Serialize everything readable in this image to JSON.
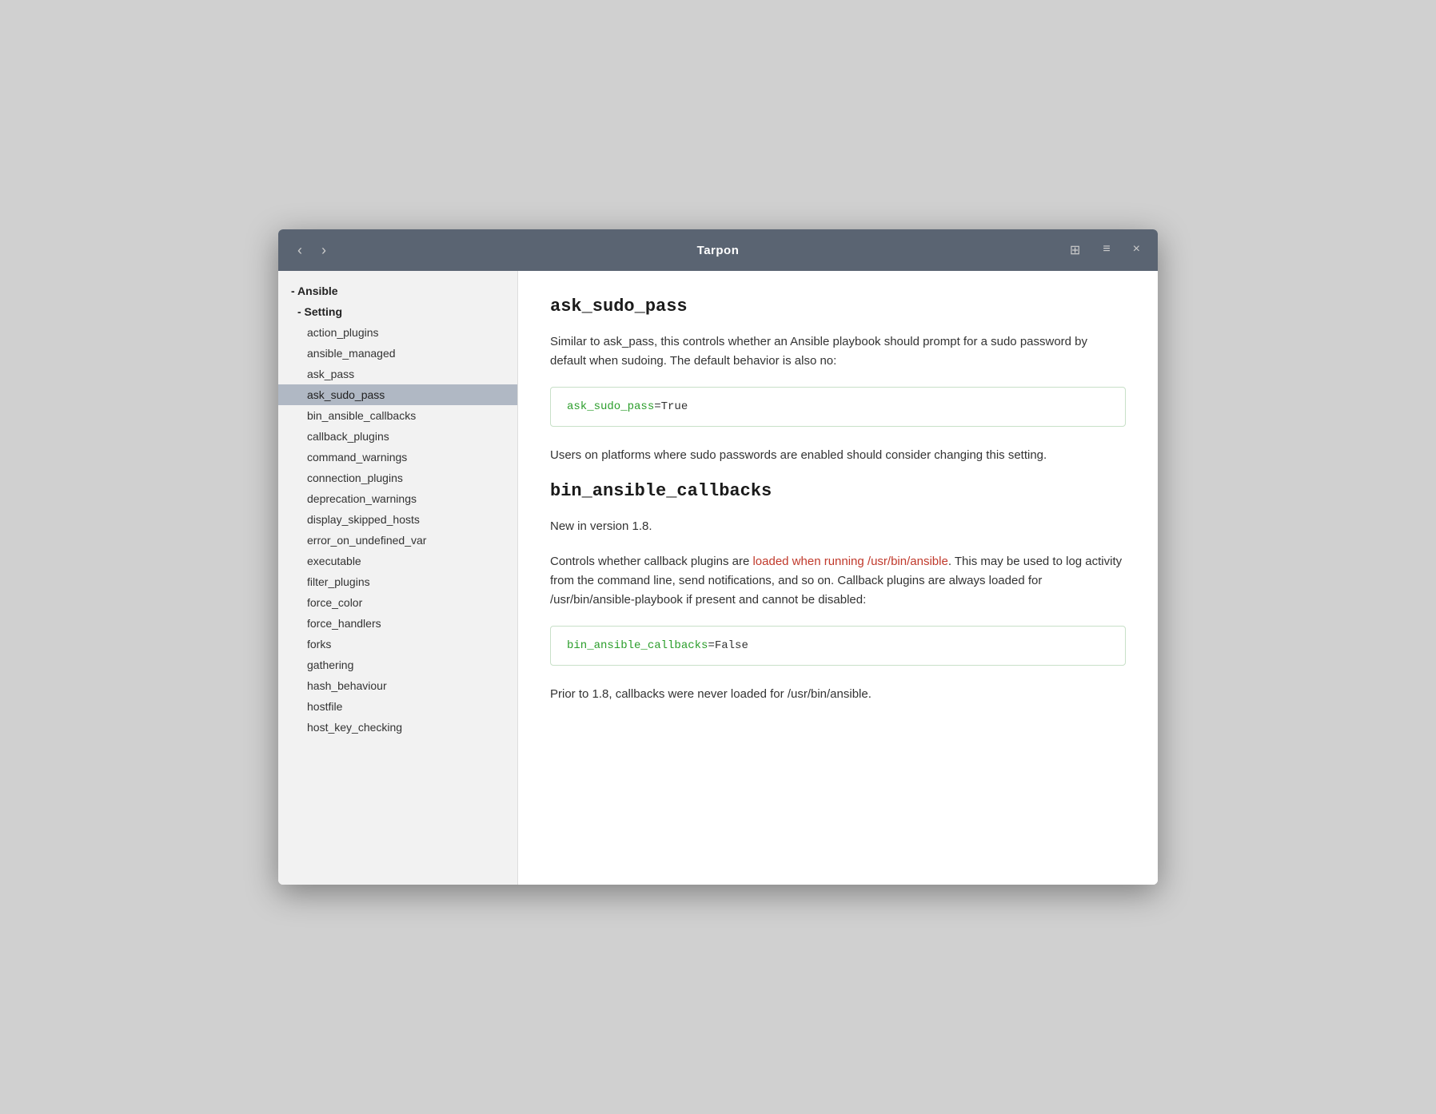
{
  "titlebar": {
    "title": "Tarpon",
    "nav_back": "‹",
    "nav_forward": "›",
    "ctrl_pin": "⊞",
    "ctrl_menu": "≡",
    "ctrl_close": "×"
  },
  "sidebar": {
    "ansible_label": "- Ansible",
    "setting_label": "- Setting",
    "items": [
      {
        "id": "action_plugins",
        "label": "action_plugins",
        "selected": false
      },
      {
        "id": "ansible_managed",
        "label": "ansible_managed",
        "selected": false
      },
      {
        "id": "ask_pass",
        "label": "ask_pass",
        "selected": false
      },
      {
        "id": "ask_sudo_pass",
        "label": "ask_sudo_pass",
        "selected": true
      },
      {
        "id": "bin_ansible_callbacks",
        "label": "bin_ansible_callbacks",
        "selected": false
      },
      {
        "id": "callback_plugins",
        "label": "callback_plugins",
        "selected": false
      },
      {
        "id": "command_warnings",
        "label": "command_warnings",
        "selected": false
      },
      {
        "id": "connection_plugins",
        "label": "connection_plugins",
        "selected": false
      },
      {
        "id": "deprecation_warnings",
        "label": "deprecation_warnings",
        "selected": false
      },
      {
        "id": "display_skipped_hosts",
        "label": "display_skipped_hosts",
        "selected": false
      },
      {
        "id": "error_on_undefined_var",
        "label": "error_on_undefined_var",
        "selected": false
      },
      {
        "id": "executable",
        "label": "executable",
        "selected": false
      },
      {
        "id": "filter_plugins",
        "label": "filter_plugins",
        "selected": false
      },
      {
        "id": "force_color",
        "label": "force_color",
        "selected": false
      },
      {
        "id": "force_handlers",
        "label": "force_handlers",
        "selected": false
      },
      {
        "id": "forks",
        "label": "forks",
        "selected": false
      },
      {
        "id": "gathering",
        "label": "gathering",
        "selected": false
      },
      {
        "id": "hash_behaviour",
        "label": "hash_behaviour",
        "selected": false
      },
      {
        "id": "hostfile",
        "label": "hostfile",
        "selected": false
      },
      {
        "id": "host_key_checking",
        "label": "host_key_checking",
        "selected": false
      }
    ]
  },
  "main": {
    "sections": [
      {
        "id": "ask_sudo_pass",
        "title": "ask_sudo_pass",
        "paragraphs": [
          "Similar to ask_pass, this controls whether an Ansible playbook should prompt for a sudo password by default when sudoing. The default behavior is also no:"
        ],
        "code": {
          "key": "ask_sudo_pass",
          "value": "=True"
        },
        "paragraphs2": [
          "Users on platforms where sudo passwords are enabled should consider changing this setting."
        ]
      },
      {
        "id": "bin_ansible_callbacks",
        "title": "bin_ansible_callbacks",
        "version_note": "New in version 1.8.",
        "paragraphs": [
          "Controls whether callback plugins are loaded when running /usr/bin/ansible. This may be used to log activity from the command line, send notifications, and so on. Callback plugins are always loaded for /usr/bin/ansible-playbook if present and cannot be disabled:"
        ],
        "code": {
          "key": "bin_ansible_callbacks",
          "value": "=False"
        },
        "paragraphs2": [
          "Prior to 1.8, callbacks were never loaded for /usr/bin/ansible."
        ]
      }
    ]
  }
}
